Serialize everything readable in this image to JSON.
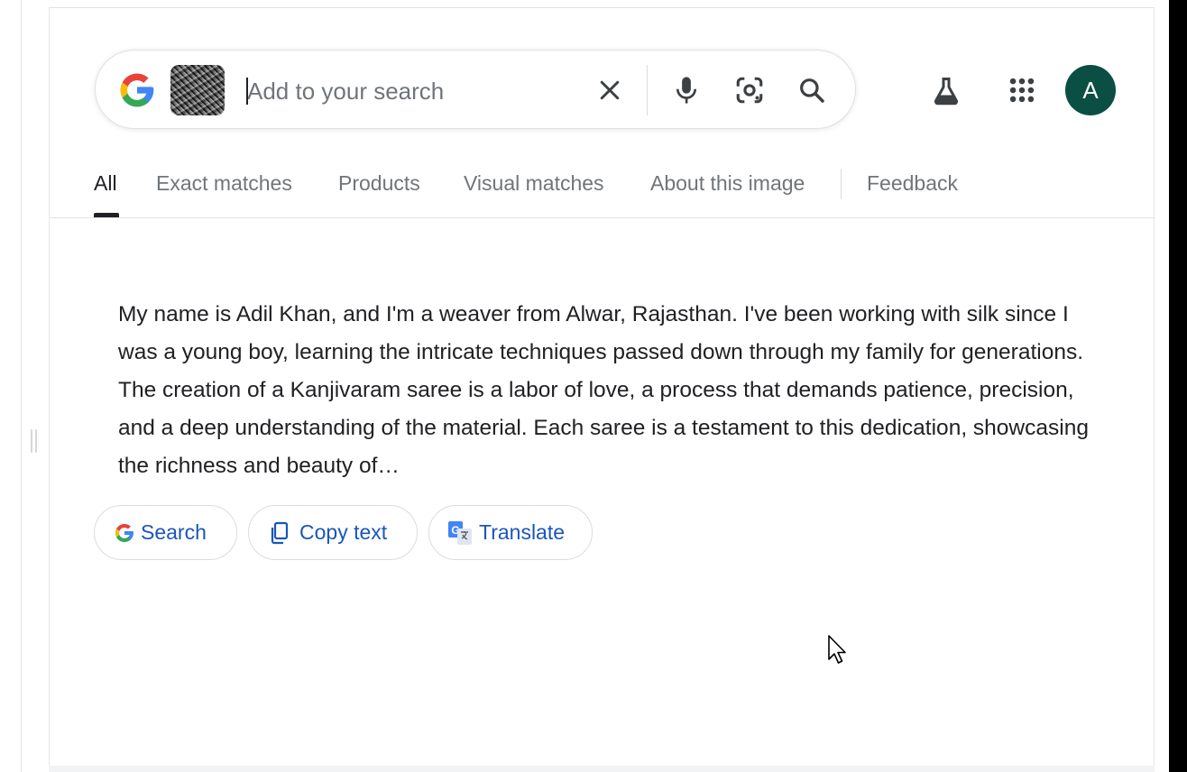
{
  "search": {
    "placeholder": "Add to your search"
  },
  "tabs": [
    {
      "label": "All",
      "active": true
    },
    {
      "label": "Exact matches"
    },
    {
      "label": "Products"
    },
    {
      "label": "Visual matches"
    },
    {
      "label": "About this image"
    },
    {
      "label": "Feedback"
    }
  ],
  "account": {
    "initial": "A",
    "avatar_color": "#0b4f44"
  },
  "extracted_text": "My name is Adil Khan, and I'm a weaver from Alwar, Rajasthan. I've been working with silk since I was a young boy, learning the intricate techniques passed down through my family for generations. The creation of a Kanjivaram saree is a labor of love, a process that demands patience, precision, and a deep understanding of the material. Each saree is a testament to this dedication, showcasing the richness and beauty of…",
  "actions": {
    "search_label": "Search",
    "copy_label": "Copy text",
    "translate_label": "Translate"
  },
  "colors": {
    "link_blue": "#1a56b9",
    "google_blue": "#4285f4",
    "google_red": "#ea4335",
    "google_yellow": "#fbbc05",
    "google_green": "#34a853"
  },
  "icons": [
    "google-logo",
    "image-thumbnail",
    "close-icon",
    "microphone-icon",
    "lens-camera-icon",
    "search-icon",
    "labs-flask-icon",
    "apps-grid-icon",
    "copy-icon",
    "translate-icon"
  ]
}
